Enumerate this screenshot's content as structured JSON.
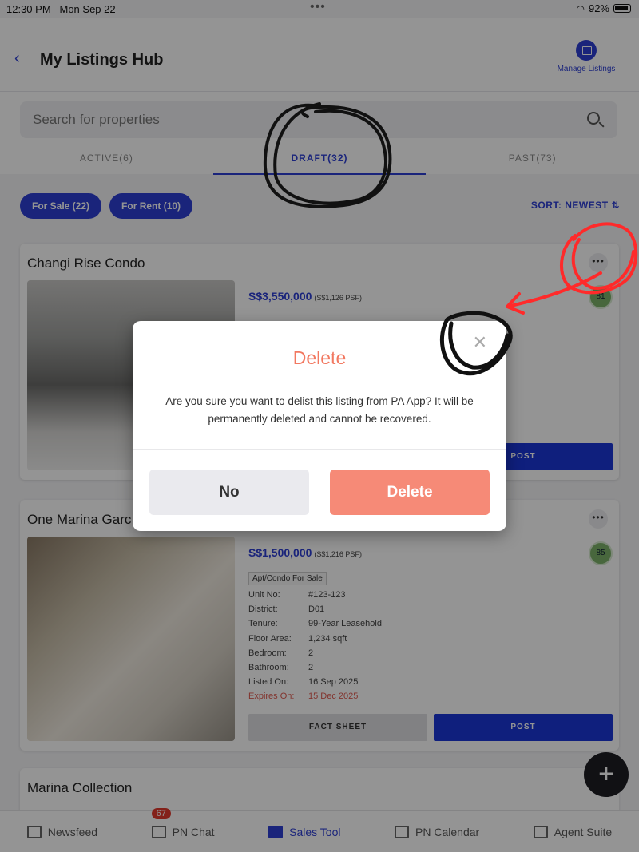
{
  "status_bar": {
    "time": "12:30 PM",
    "date": "Mon Sep 22",
    "battery": "92%"
  },
  "header": {
    "title": "My Listings Hub",
    "manage_label": "Manage Listings"
  },
  "search": {
    "placeholder": "Search for properties"
  },
  "tabs": [
    {
      "label": "ACTIVE(6)"
    },
    {
      "label": "DRAFT(32)"
    },
    {
      "label": "PAST(73)"
    }
  ],
  "filters": [
    {
      "label": "For Sale (22)"
    },
    {
      "label": "For Rent (10)"
    }
  ],
  "sort_label": "SORT: NEWEST",
  "listings": [
    {
      "title": "Changi Rise Condo",
      "price": "S$3,550,000",
      "psf": "(S$1,126 PSF)",
      "score": "81",
      "post_label": "POST"
    },
    {
      "title": "One Marina Garc",
      "price": "S$1,500,000",
      "psf": "(S$1,216 PSF)",
      "score": "85",
      "type": "Apt/Condo For Sale",
      "details": [
        {
          "k": "Unit No:",
          "v": "#123-123"
        },
        {
          "k": "District:",
          "v": "D01"
        },
        {
          "k": "Tenure:",
          "v": "99-Year Leasehold"
        },
        {
          "k": "Floor Area:",
          "v": "1,234 sqft"
        },
        {
          "k": "Bedroom:",
          "v": "2"
        },
        {
          "k": "Bathroom:",
          "v": "2"
        },
        {
          "k": "Listed On:",
          "v": "16 Sep 2025"
        },
        {
          "k": "Expires On:",
          "v": "15 Dec 2025"
        }
      ],
      "fact_sheet_label": "FACT SHEET",
      "post_label": "POST"
    },
    {
      "title": "Marina Collection"
    }
  ],
  "bottom_nav": [
    {
      "label": "Newsfeed"
    },
    {
      "label": "PN Chat",
      "badge": "67"
    },
    {
      "label": "Sales Tool"
    },
    {
      "label": "PN Calendar"
    },
    {
      "label": "Agent Suite"
    }
  ],
  "modal": {
    "title": "Delete",
    "message": "Are you sure you want to delist this listing from PA App? It will be permanently deleted and cannot be recovered.",
    "no_label": "No",
    "delete_label": "Delete"
  },
  "colors": {
    "accent": "#2d3fd4",
    "delete": "#f68a77",
    "expires": "#e05a50",
    "annotation_red": "#ff2a2a"
  }
}
